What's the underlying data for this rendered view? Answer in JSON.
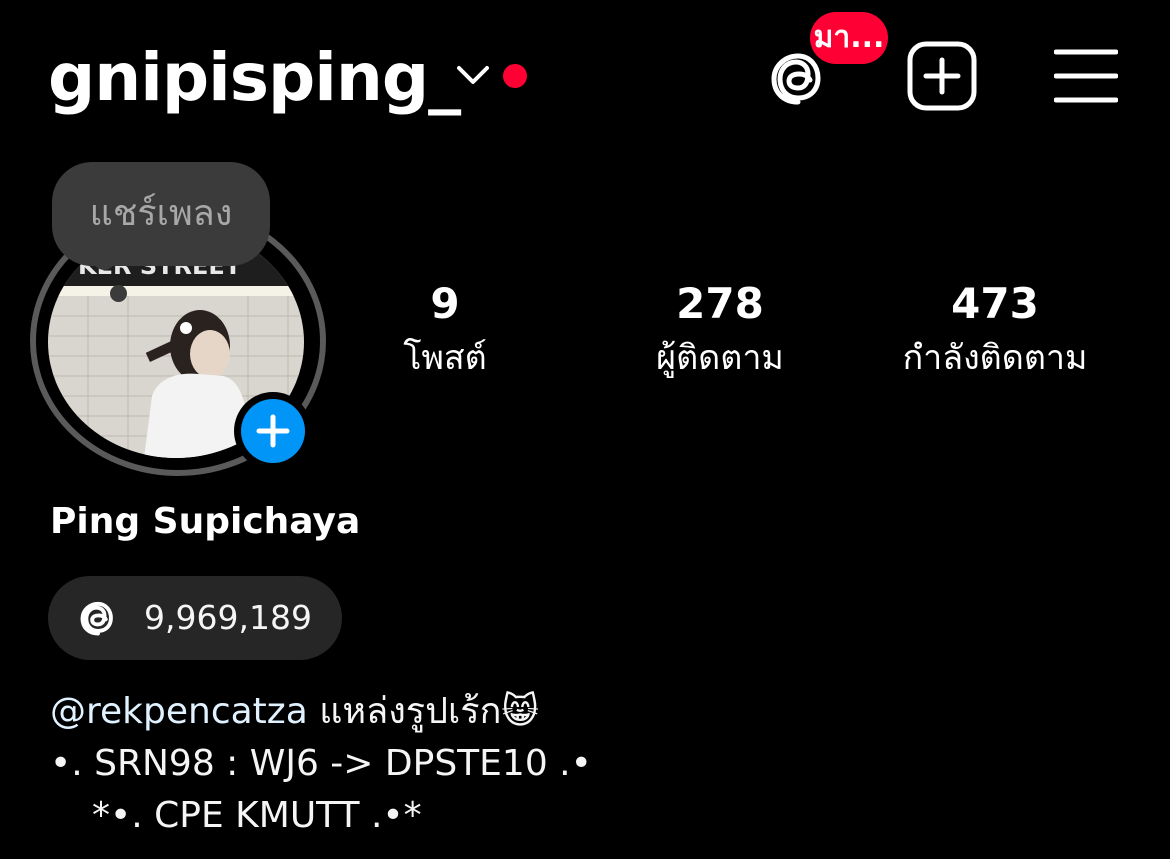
{
  "header": {
    "username": "gnipisping_",
    "threads_badge": "มา...",
    "icons": {
      "switch": "chevron-down-icon",
      "threads": "threads-icon",
      "create": "plus-square-icon",
      "menu": "hamburger-menu-icon"
    },
    "colors": {
      "notification": "#ff0034"
    }
  },
  "profile": {
    "note": "แชร์เพลง",
    "avatar": "profile-photo",
    "add_story_icon": "plus-icon",
    "add_story_color": "#0095f6",
    "stats": {
      "posts": {
        "value": "9",
        "label": "โพสต์"
      },
      "followers": {
        "value": "278",
        "label": "ผู้ติดตาม"
      },
      "following": {
        "value": "473",
        "label": "กำลังติดตาม"
      }
    },
    "display_name": "Ping Supichaya",
    "threads_pill": {
      "icon": "threads-icon",
      "count": "9,969,189"
    },
    "bio": {
      "mention": "@rekpencatza",
      "line1_text": " แหล่งรูปเร้ก😸",
      "line2": "•. SRN98 : WJ6 -> DPSTE10 .•",
      "line3": "*•. CPE KMUTT .•*"
    }
  }
}
